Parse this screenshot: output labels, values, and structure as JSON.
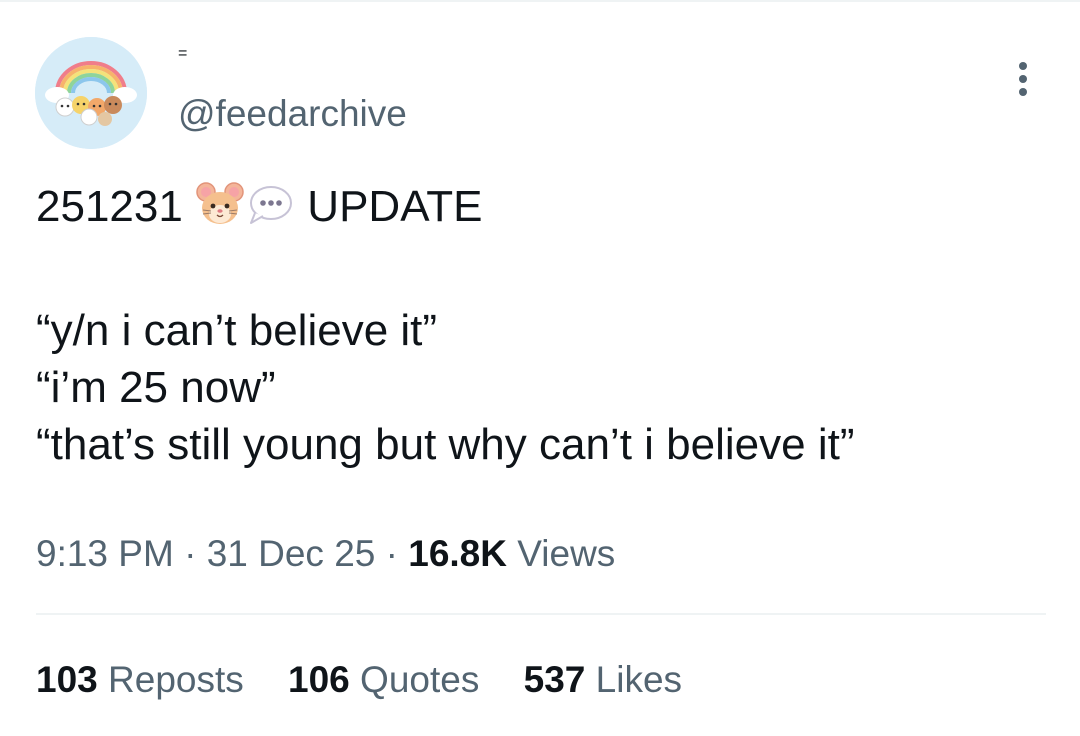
{
  "user": {
    "display_name": "=",
    "handle": "@feedarchive",
    "avatar_icon": "avatar-image"
  },
  "tweet": {
    "line1_prefix": "251231",
    "line1_emojis": [
      "hamster-face-icon",
      "speech-bubble-icon"
    ],
    "line1_suffix": "UPDATE",
    "line2": "“y/n i can’t believe it”",
    "line3": "“i’m 25 now”",
    "line4": "“that’s still young but why can’t i believe it”"
  },
  "meta": {
    "time": "9:13 PM",
    "sep1": " · ",
    "date": "31 Dec 25",
    "sep2": " · ",
    "views_count": "16.8K",
    "views_label": "Views"
  },
  "stats": {
    "reposts_count": "103",
    "reposts_label": "Reposts",
    "quotes_count": "106",
    "quotes_label": "Quotes",
    "likes_count": "537",
    "likes_label": "Likes"
  },
  "more_icon": "more-dots-icon"
}
